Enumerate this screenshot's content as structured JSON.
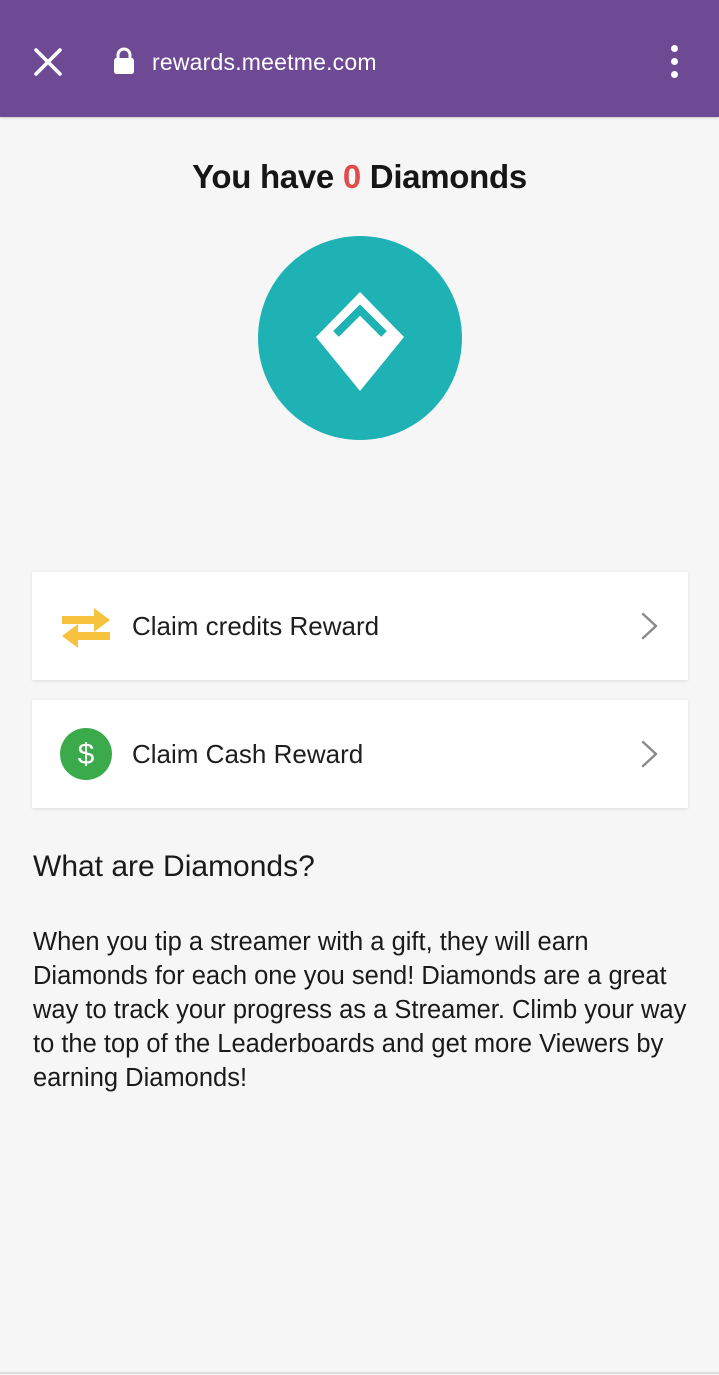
{
  "browser": {
    "url": "rewards.meetme.com",
    "close_icon": "close-icon",
    "lock_icon": "lock-icon",
    "menu_icon": "more-vert-icon",
    "bar_color": "#6e4a94"
  },
  "header": {
    "title_prefix": "You have",
    "diamond_count": "0",
    "title_suffix": "Diamonds",
    "count_color": "#e04c4c"
  },
  "badge": {
    "icon": "diamond-icon",
    "color": "#1fb2b4"
  },
  "rewards": [
    {
      "label": "Claim credits Reward",
      "icon": "swap-arrows-icon",
      "icon_color": "#f7c23e"
    },
    {
      "label": "Claim Cash Reward",
      "icon": "dollar-coin-icon",
      "icon_color": "#3aaa4a",
      "icon_glyph": "$"
    }
  ],
  "info": {
    "heading": "What are Diamonds?",
    "body": "When you tip a streamer with a gift, they will earn Diamonds for each one you send! Diamonds are a great way to track your progress as a Streamer. Climb your way to the top of the Leaderboards and get more Viewers by earning Diamonds!"
  }
}
